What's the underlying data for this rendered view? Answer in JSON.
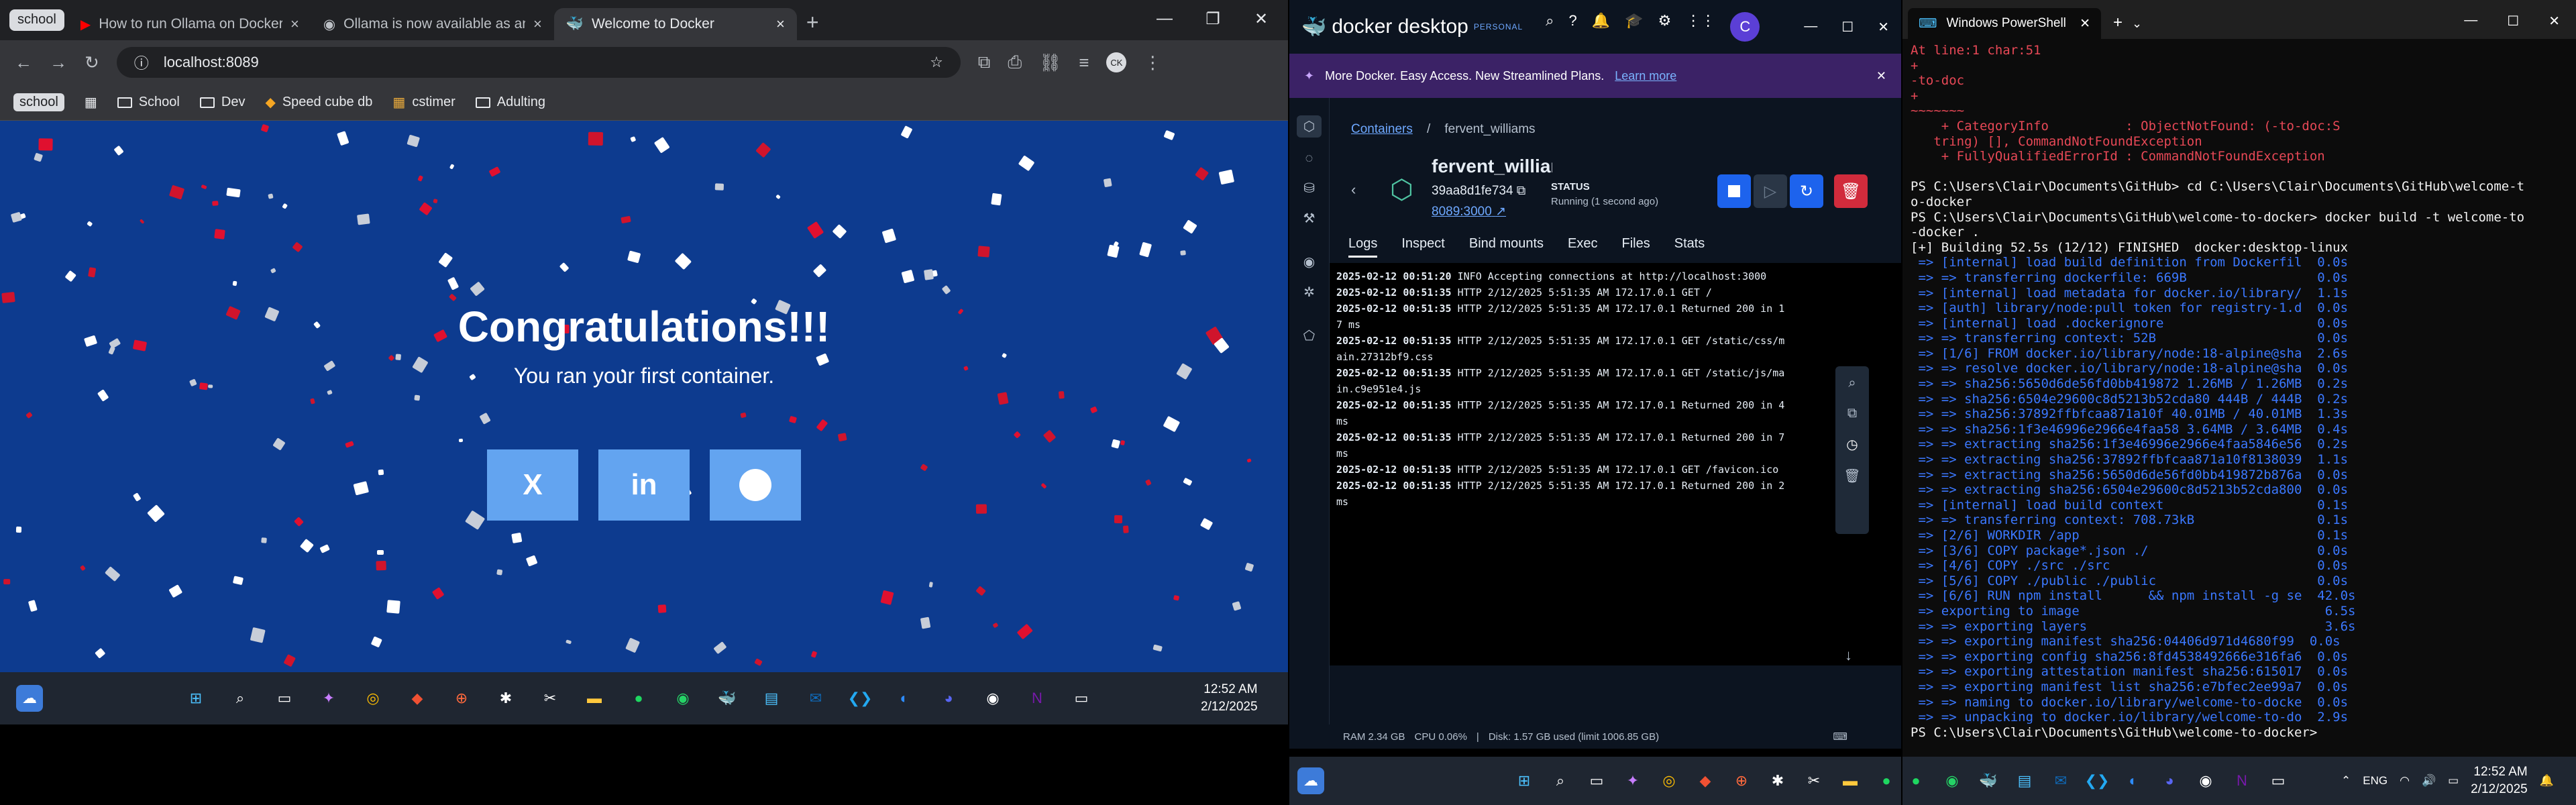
{
  "chrome": {
    "tab_group": "school",
    "tabs": [
      {
        "title": "How to run Ollama on Docker",
        "favicon": "youtube-icon"
      },
      {
        "title": "Ollama is now available as an o",
        "favicon": "github-icon"
      },
      {
        "title": "Welcome to Docker",
        "favicon": "docker-icon",
        "active": true
      }
    ],
    "url": "localhost:8089",
    "profile_initials": "CK",
    "bookmarks": {
      "school_chip": "school",
      "items": [
        "School",
        "Dev",
        "Speed cube db",
        "cstimer",
        "Adulting"
      ]
    },
    "page": {
      "title": "Congratulations!!!",
      "subtitle": "You ran your first container.",
      "share": [
        "X",
        "in",
        "reddit"
      ],
      "background": "#0d3b8f"
    },
    "clock": {
      "time": "12:52 AM",
      "date": "2/12/2025"
    }
  },
  "docker": {
    "brand": "docker desktop",
    "plan": "PERSONAL",
    "avatar": "C",
    "banner": {
      "text": "More Docker. Easy Access. New Streamlined Plans.",
      "link": "Learn more"
    },
    "breadcrumb": {
      "root": "Containers",
      "current": "fervent_williams"
    },
    "container": {
      "name": "fervent_williams",
      "id": "39aa8d1fe734",
      "port": "8089:3000",
      "status_label": "STATUS",
      "status": "Running (1 second ago)"
    },
    "tabs": [
      "Logs",
      "Inspect",
      "Bind mounts",
      "Exec",
      "Files",
      "Stats"
    ],
    "logs": [
      {
        "ts": "2025-02-12 00:51:20",
        "msg": " INFO  Accepting connections at http://localhost:3000"
      },
      {
        "ts": "2025-02-12 00:51:35",
        "msg": " HTTP  2/12/2025 5:51:35 AM 172.17.0.1 GET /"
      },
      {
        "ts": "2025-02-12 00:51:35",
        "msg": " HTTP  2/12/2025 5:51:35 AM 172.17.0.1 Returned 200 in 1"
      },
      {
        "ts": "",
        "msg": "7 ms"
      },
      {
        "ts": "2025-02-12 00:51:35",
        "msg": " HTTP  2/12/2025 5:51:35 AM 172.17.0.1 GET /static/css/m"
      },
      {
        "ts": "",
        "msg": "ain.27312bf9.css"
      },
      {
        "ts": "2025-02-12 00:51:35",
        "msg": " HTTP  2/12/2025 5:51:35 AM 172.17.0.1 GET /static/js/ma"
      },
      {
        "ts": "",
        "msg": "in.c9e951e4.js"
      },
      {
        "ts": "2025-02-12 00:51:35",
        "msg": " HTTP  2/12/2025 5:51:35 AM 172.17.0.1 Returned 200 in 4"
      },
      {
        "ts": "",
        "msg": " ms"
      },
      {
        "ts": "2025-02-12 00:51:35",
        "msg": " HTTP  2/12/2025 5:51:35 AM 172.17.0.1 Returned 200 in 7"
      },
      {
        "ts": "",
        "msg": " ms"
      },
      {
        "ts": "2025-02-12 00:51:35",
        "msg": " HTTP  2/12/2025 5:51:35 AM 172.17.0.1 GET /favicon.ico"
      },
      {
        "ts": "2025-02-12 00:51:35",
        "msg": " HTTP  2/12/2025 5:51:35 AM 172.17.0.1 Returned 200 in 2"
      },
      {
        "ts": "",
        "msg": " ms"
      }
    ],
    "footer": {
      "ram": "RAM 2.34 GB",
      "cpu": "CPU 0.06%",
      "disk": "Disk: 1.57 GB used (limit 1006.85 GB)"
    }
  },
  "powershell": {
    "tab_title": "Windows PowerShell",
    "lines": [
      {
        "c": "red",
        "t": "At line:1 char:51"
      },
      {
        "c": "red",
        "t": "+"
      },
      {
        "c": "red",
        "t": "-to-doc"
      },
      {
        "c": "red",
        "t": "+"
      },
      {
        "c": "red",
        "t": "~~~~~~~"
      },
      {
        "c": "red",
        "t": "    + CategoryInfo          : ObjectNotFound: (-to-doc:S"
      },
      {
        "c": "red",
        "t": "   tring) [], CommandNotFoundException"
      },
      {
        "c": "red",
        "t": "    + FullyQualifiedErrorId : CommandNotFoundException"
      },
      {
        "c": "white",
        "t": ""
      },
      {
        "c": "white",
        "t": "PS C:\\Users\\Clair\\Documents\\GitHub> cd C:\\Users\\Clair\\Documents\\GitHub\\welcome-t"
      },
      {
        "c": "white",
        "t": "o-docker"
      },
      {
        "c": "white",
        "t": "PS C:\\Users\\Clair\\Documents\\GitHub\\welcome-to-docker> docker build -t welcome-to"
      },
      {
        "c": "white",
        "t": "-docker ."
      },
      {
        "c": "white",
        "t": "[+] Building 52.5s (12/12) FINISHED  docker:desktop-linux"
      },
      {
        "c": "blue",
        "t": " => [internal] load build definition from Dockerfil  0.0s"
      },
      {
        "c": "blue",
        "t": " => => transferring dockerfile: 669B                 0.0s"
      },
      {
        "c": "blue",
        "t": " => [internal] load metadata for docker.io/library/  1.1s"
      },
      {
        "c": "blue",
        "t": " => [auth] library/node:pull token for registry-1.d  0.0s"
      },
      {
        "c": "blue",
        "t": " => [internal] load .dockerignore                    0.0s"
      },
      {
        "c": "blue",
        "t": " => => transferring context: 52B                     0.0s"
      },
      {
        "c": "blue",
        "t": " => [1/6] FROM docker.io/library/node:18-alpine@sha  2.6s"
      },
      {
        "c": "blue",
        "t": " => => resolve docker.io/library/node:18-alpine@sha  0.0s"
      },
      {
        "c": "blue",
        "t": " => => sha256:5650d6de56fd0bb419872 1.26MB / 1.26MB  0.2s"
      },
      {
        "c": "blue",
        "t": " => => sha256:6504e29600c8d5213b52cda80 444B / 444B  0.2s"
      },
      {
        "c": "blue",
        "t": " => => sha256:37892ffbfcaa871a10f 40.01MB / 40.01MB  1.3s"
      },
      {
        "c": "blue",
        "t": " => => sha256:1f3e46996e2966e4faa58 3.64MB / 3.64MB  0.4s"
      },
      {
        "c": "blue",
        "t": " => => extracting sha256:1f3e46996e2966e4faa5846e56  0.2s"
      },
      {
        "c": "blue",
        "t": " => => extracting sha256:37892ffbfcaa871a10f8138039  1.1s"
      },
      {
        "c": "blue",
        "t": " => => extracting sha256:5650d6de56fd0bb419872b876a  0.0s"
      },
      {
        "c": "blue",
        "t": " => => extracting sha256:6504e29600c8d5213b52cda800  0.0s"
      },
      {
        "c": "blue",
        "t": " => [internal] load build context                    0.1s"
      },
      {
        "c": "blue",
        "t": " => => transferring context: 708.73kB                0.1s"
      },
      {
        "c": "blue",
        "t": " => [2/6] WORKDIR /app                               0.1s"
      },
      {
        "c": "blue",
        "t": " => [3/6] COPY package*.json ./                      0.0s"
      },
      {
        "c": "blue",
        "t": " => [4/6] COPY ./src ./src                           0.0s"
      },
      {
        "c": "blue",
        "t": " => [5/6] COPY ./public ./public                     0.0s"
      },
      {
        "c": "blue",
        "t": " => [6/6] RUN npm install      && npm install -g se  42.0s"
      },
      {
        "c": "blue",
        "t": " => exporting to image                                6.5s"
      },
      {
        "c": "blue",
        "t": " => => exporting layers                               3.6s"
      },
      {
        "c": "blue",
        "t": " => => exporting manifest sha256:04406d971d4680f99  0.0s"
      },
      {
        "c": "blue",
        "t": " => => exporting config sha256:8fd4538492666e316fa6  0.0s"
      },
      {
        "c": "blue",
        "t": " => => exporting attestation manifest sha256:615017  0.0s"
      },
      {
        "c": "blue",
        "t": " => => exporting manifest list sha256:e7bfec2ee99a7  0.0s"
      },
      {
        "c": "blue",
        "t": " => => naming to docker.io/library/welcome-to-docke  0.0s"
      },
      {
        "c": "blue",
        "t": " => => unpacking to docker.io/library/welcome-to-do  2.9s"
      },
      {
        "c": "white",
        "t": "PS C:\\Users\\Clair\\Documents\\GitHub\\welcome-to-docker> "
      }
    ]
  },
  "system_tray": {
    "lang": "ENG",
    "time": "12:52 AM",
    "date": "2/12/2025"
  }
}
